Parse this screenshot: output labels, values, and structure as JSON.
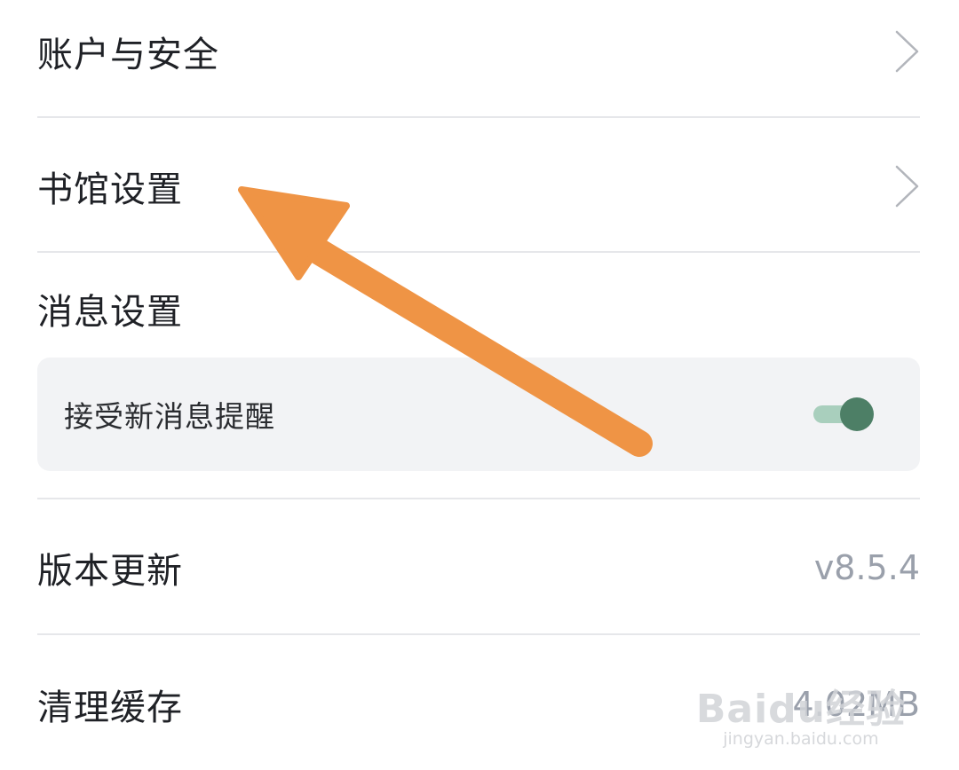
{
  "settings": {
    "account_security": "账户与安全",
    "library_settings": "书馆设置",
    "message_settings": "消息设置",
    "receive_new_messages": "接受新消息提醒",
    "receive_new_messages_on": true,
    "version_update": "版本更新",
    "version_value": "v8.5.4",
    "clear_cache": "清理缓存",
    "cache_size": "4.02MB"
  },
  "annotation": {
    "arrow_color": "#ef9445",
    "points_to": "书馆设置"
  },
  "watermark": {
    "logo": "Baidu经验",
    "url": "jingyan.baidu.com"
  },
  "colors": {
    "toggle_knob": "#4d7f66",
    "toggle_track": "#a9cfbd",
    "panel_bg": "#f2f3f5",
    "divider": "#e6e7ea"
  }
}
